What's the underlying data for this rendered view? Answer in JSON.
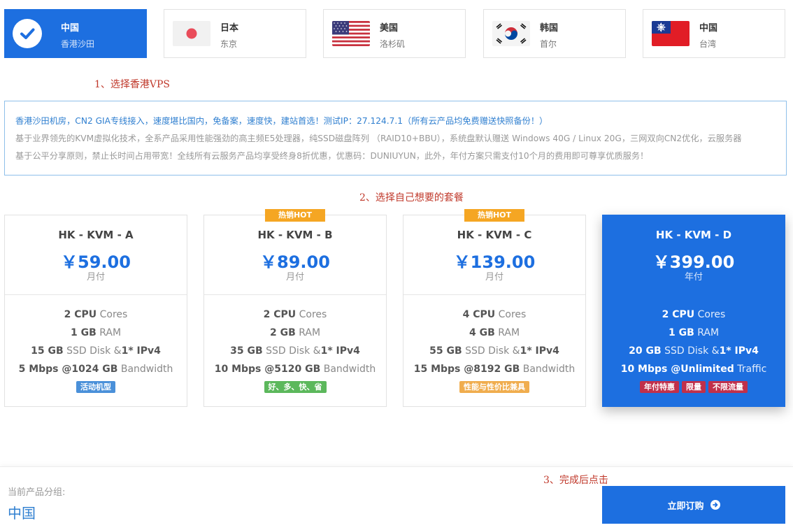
{
  "regions": [
    {
      "name": "中国",
      "sub": "香港沙田",
      "flag": "check-icon",
      "active": true
    },
    {
      "name": "日本",
      "sub": "东京",
      "flag": "japan-flag-icon"
    },
    {
      "name": "美国",
      "sub": "洛杉矶",
      "flag": "usa-flag-icon"
    },
    {
      "name": "韩国",
      "sub": "首尔",
      "flag": "korea-flag-icon"
    },
    {
      "name": "中国",
      "sub": "台湾",
      "flag": "taiwan-flag-icon"
    }
  ],
  "annotations": {
    "step1": "1、选择香港VPS",
    "step2": "2、选择自己想要的套餐",
    "step3": "3、完成后点击"
  },
  "info": {
    "line1": "香港沙田机房，CN2 GIA专线接入，速度堪比国内，免备案，速度快，建站首选！测试IP：27.124.7.1（所有云产品均免费赠送快照备份！）",
    "line2": "基于业界领先的KVM虚拟化技术，全系产品采用性能强劲的高主频E5处理器，纯SSD磁盘阵列 （RAID10+BBU），系统盘默认赠送 Windows 40G / Linux 20G，三网双向CN2优化，云服务器",
    "line3": "基于公平分享原则，禁止长时间占用带宽！全线所有云服务产品均享受终身8折优惠，优惠码：DUNIUYUN，此外，年付方案只需支付10个月的费用即可尊享优质服务！"
  },
  "plans": [
    {
      "name": "HK - KVM - A",
      "price": "￥59.00",
      "cycle": "月付",
      "hot": "",
      "cpu": "2 CPU",
      "cpu_unit": "Cores",
      "ram": "1 GB",
      "ram_unit": "RAM",
      "disk": "15 GB",
      "disk_unit": "SSD Disk &",
      "ipv4": "1* IPv4",
      "bw": "5 Mbps @1024 GB",
      "bw_unit": "Bandwidth",
      "tags": [
        {
          "label": "活动机型",
          "color": "#4a90d9"
        }
      ]
    },
    {
      "name": "HK - KVM - B",
      "price": "￥89.00",
      "cycle": "月付",
      "hot": "热销HOT",
      "cpu": "2 CPU",
      "cpu_unit": "Cores",
      "ram": "2 GB",
      "ram_unit": "RAM",
      "disk": "35 GB",
      "disk_unit": "SSD Disk &",
      "ipv4": "1* IPv4",
      "bw": "10 Mbps @5120 GB",
      "bw_unit": "Bandwidth",
      "tags": [
        {
          "label": "好、多、快、省",
          "color": "#5cb85c"
        }
      ]
    },
    {
      "name": "HK - KVM - C",
      "price": "￥139.00",
      "cycle": "月付",
      "hot": "热销HOT",
      "cpu": "4 CPU",
      "cpu_unit": "Cores",
      "ram": "4 GB",
      "ram_unit": "RAM",
      "disk": "55 GB",
      "disk_unit": "SSD Disk &",
      "ipv4": "1* IPv4",
      "bw": "15 Mbps @8192 GB",
      "bw_unit": "Bandwidth",
      "tags": [
        {
          "label": "性能与性价比兼具",
          "color": "#f0ad4e"
        }
      ]
    },
    {
      "name": "HK - KVM - D",
      "price": "￥399.00",
      "cycle": "年付",
      "hot": "",
      "active": true,
      "cpu": "2 CPU",
      "cpu_unit": "Cores",
      "ram": "1 GB",
      "ram_unit": "RAM",
      "disk": "20 GB",
      "disk_unit": "SSD Disk &",
      "ipv4": "1* IPv4",
      "bw": "10 Mbps @Unlimited",
      "bw_unit": "Traffic",
      "tags": [
        {
          "label": "年付特惠",
          "color": "#c0304b"
        },
        {
          "label": "限量",
          "color": "#c0304b"
        },
        {
          "label": "不限流量",
          "color": "#c0304b"
        }
      ]
    }
  ],
  "bottom": {
    "group_label": "当前产品分组:",
    "group_value": "中国",
    "order_button": "立即订购"
  },
  "colors": {
    "accent": "#1d6fe0",
    "annotation": "#c0392b"
  }
}
